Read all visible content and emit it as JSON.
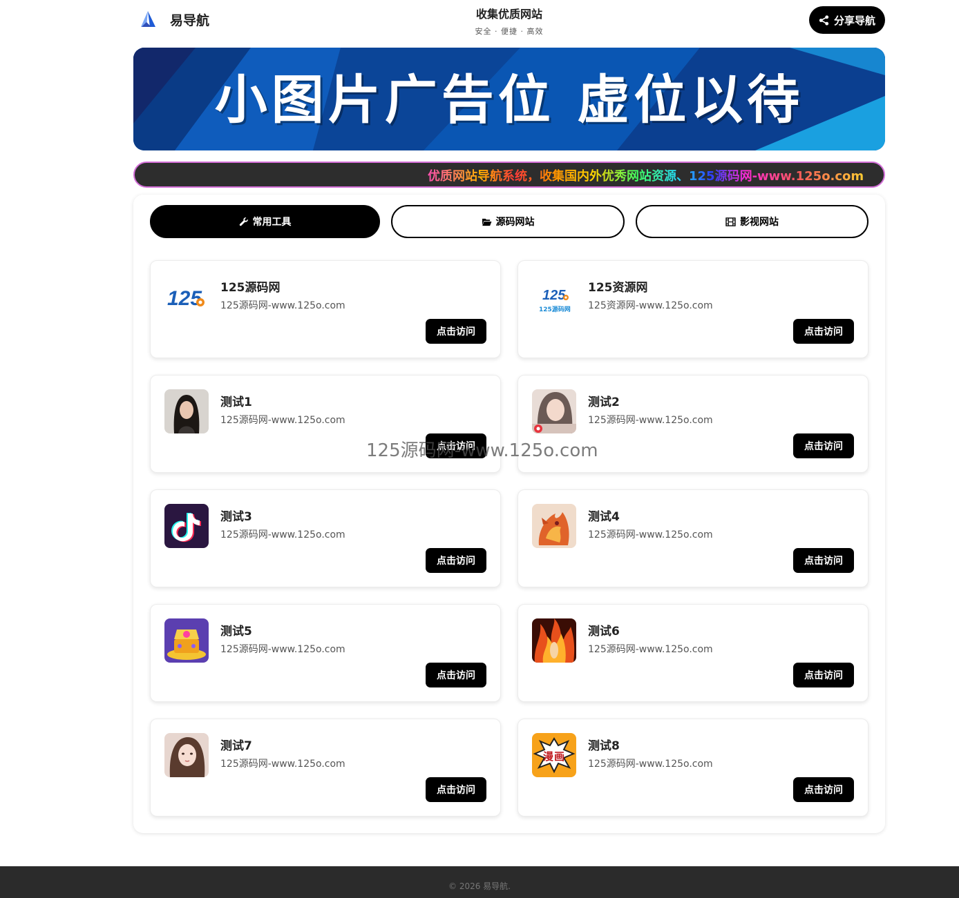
{
  "header": {
    "logo_text": "易导航",
    "slogan_title": "收集优质网站",
    "slogan_sub": "安全 · 便捷 · 高效",
    "share_label": "分享导航"
  },
  "banner": {
    "text": "小图片广告位 虚位以待"
  },
  "marquee": {
    "text": "优质网站导航系统，收集国内外优秀网站资源、125源码网-www.125o.com"
  },
  "tabs": [
    {
      "label": "常用工具",
      "icon": "wrench-icon",
      "active": true
    },
    {
      "label": "源码网站",
      "icon": "folder-open-icon",
      "active": false
    },
    {
      "label": "影视网站",
      "icon": "film-icon",
      "active": false
    }
  ],
  "cards": [
    {
      "title": "125源码网",
      "url": "125源码网-www.125o.com",
      "button": "点击访问",
      "thumb": "125-logo"
    },
    {
      "title": "125资源网",
      "url": "125资源网-www.125o.com",
      "button": "点击访问",
      "thumb": "125-logo-small",
      "thumb_caption": "125源码网"
    },
    {
      "title": "测试1",
      "url": "125源码网-www.125o.com",
      "button": "点击访问",
      "thumb": "portrait-woman-dark-hair"
    },
    {
      "title": "测试2",
      "url": "125源码网-www.125o.com",
      "button": "点击访问",
      "thumb": "anime-girl-game"
    },
    {
      "title": "测试3",
      "url": "125源码网-www.125o.com",
      "button": "点击访问",
      "thumb": "tiktok-logo"
    },
    {
      "title": "测试4",
      "url": "125源码网-www.125o.com",
      "button": "点击访问",
      "thumb": "dragon-game"
    },
    {
      "title": "测试5",
      "url": "125源码网-www.125o.com",
      "button": "点击访问",
      "thumb": "treasure-chest-game"
    },
    {
      "title": "测试6",
      "url": "125源码网-www.125o.com",
      "button": "点击访问",
      "thumb": "fire-character"
    },
    {
      "title": "测试7",
      "url": "125源码网-www.125o.com",
      "button": "点击访问",
      "thumb": "portrait-young-woman"
    },
    {
      "title": "测试8",
      "url": "125源码网-www.125o.com",
      "button": "点击访问",
      "thumb": "manga-comic-icon",
      "thumb_caption": "漫画"
    }
  ],
  "watermark": "125源码网-www.125o.com",
  "footer": {
    "text": "© 2026 易导航."
  }
}
